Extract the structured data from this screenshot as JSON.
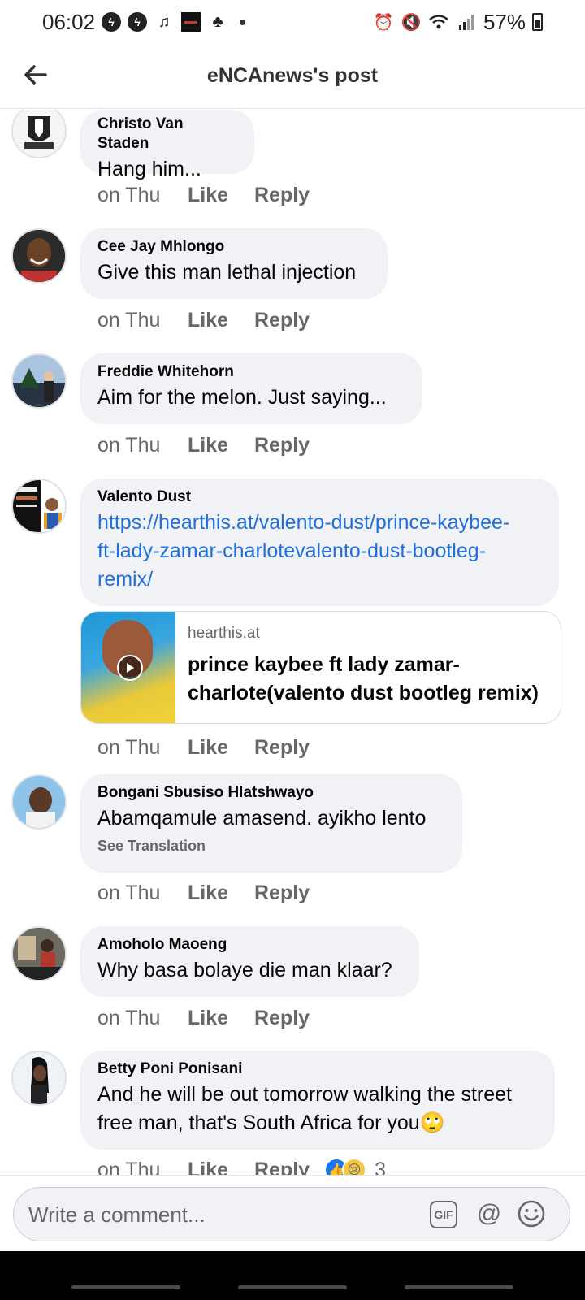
{
  "status_bar": {
    "time": "06:02",
    "battery": "57%",
    "left_icons": [
      "messenger-bolt-icon",
      "messenger-bolt-icon",
      "music-note-icon",
      "app-thumbnail-icon",
      "gym-figure-icon",
      "more-dot-icon"
    ],
    "right_icons": [
      "alarm-icon",
      "mute-icon",
      "wifi-icon",
      "signal-icon",
      "battery-icon"
    ]
  },
  "header": {
    "title": "eNCAnews's post",
    "back_icon": "back-arrow-icon"
  },
  "comments": [
    {
      "author": "Christo Van Staden",
      "text": "Hang him...",
      "time": "on Thu",
      "like": "Like",
      "reply": "Reply"
    },
    {
      "author": "Cee Jay Mhlongo",
      "text": "Give this man lethal injection",
      "time": "on Thu",
      "like": "Like",
      "reply": "Reply"
    },
    {
      "author": "Freddie Whitehorn",
      "text": "Aim for the melon. Just saying...",
      "time": "on Thu",
      "like": "Like",
      "reply": "Reply"
    },
    {
      "author": "Valento Dust",
      "link_line_1": "https://hearthis.at/valento-dust/prince-kaybee-",
      "link_line_2": "ft-lady-zamar-charlotevalento-dust-bootleg-",
      "link_line_3": "remix/",
      "preview_domain": "hearthis.at",
      "preview_title": "prince kaybee ft lady zamar-charlote(valento dust bootleg remix)",
      "time": "on Thu",
      "like": "Like",
      "reply": "Reply"
    },
    {
      "author": "Bongani Sbusiso Hlatshwayo",
      "text": "Abamqamule amasend. ayikho lento",
      "see_translation": "See Translation",
      "time": "on Thu",
      "like": "Like",
      "reply": "Reply"
    },
    {
      "author": "Amoholo Maoeng",
      "text": "Why basa bolaye die man klaar?",
      "time": "on Thu",
      "like": "Like",
      "reply": "Reply"
    },
    {
      "author": "Betty Poni Ponisani",
      "text_line_1": "And he will be out tomorrow walking the street",
      "text_line_2": "free man, that's South Africa for you🙄",
      "time": "on Thu",
      "like": "Like",
      "reply": "Reply",
      "reaction_count": "3"
    }
  ],
  "composer": {
    "placeholder": "Write a comment...",
    "gif_label": "GIF",
    "at_label": "@"
  },
  "colors": {
    "bubble": "#f0f2f5",
    "link": "#216fdb",
    "secondary_text": "#65676b",
    "like_blue": "#1877f2"
  }
}
